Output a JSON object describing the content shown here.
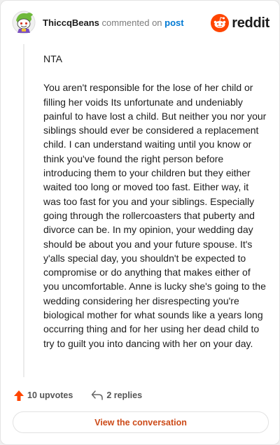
{
  "comment": {
    "username": "ThiccqBeans",
    "action_text": "commented on",
    "post_link": "post",
    "brand": "reddit",
    "paragraphs": [
      "NTA",
      "You aren't responsible for the lose of her child or filling her voids Its unfortunate and undeniably painful to have lost a child. But neither you nor your siblings should ever be considered a replacement child. I can understand waiting until you know or think you've found the right person before introducing them to your children but they either waited too long or moved too fast. Either way, it was too fast for you and your siblings. Especially going through the rollercoasters that puberty and divorce can be. In my opinion, your wedding day should be about you and your future spouse. It's y'alls special day, you shouldn't be expected to compromise or do anything that makes either of you uncomfortable. Anne is lucky she's going to the wedding considering her disrespecting you're biological mother for what sounds like a years long occurring thing and for her using her dead child to try to guilt you into dancing with her on your day."
    ],
    "upvotes": "10 upvotes",
    "replies": "2 replies",
    "view_button": "View the conversation"
  },
  "icons": {
    "avatar": "snoo-avatar-icon",
    "brand": "reddit-logo-icon",
    "upvote": "upvote-arrow-icon",
    "reply": "reply-arrow-icon"
  },
  "colors": {
    "accent": "#ff4500",
    "link": "#0079d3",
    "button_text": "#cc4a18"
  }
}
